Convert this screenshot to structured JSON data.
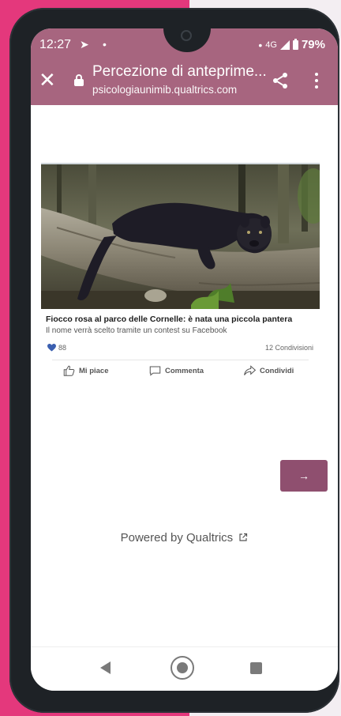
{
  "status_bar": {
    "time": "12:27",
    "network": "4G",
    "battery": "79%"
  },
  "browser": {
    "page_title": "Percezione di anteprime...",
    "url": "psicologiaunimib.qualtrics.com",
    "bar_color": "#a7657f"
  },
  "post": {
    "headline": "Fiocco rosa al parco delle Cornelle: è nata una piccola pantera",
    "subtitle": "Il nome verrà scelto tramite un contest su Facebook",
    "likes": "88",
    "shares": "12 Condivisioni",
    "actions": {
      "like": "Mi piace",
      "comment": "Commenta",
      "share": "Condividi"
    }
  },
  "survey": {
    "next_label": "→",
    "next_color": "#8f4f6f",
    "powered_by": "Powered by Qualtrics"
  }
}
